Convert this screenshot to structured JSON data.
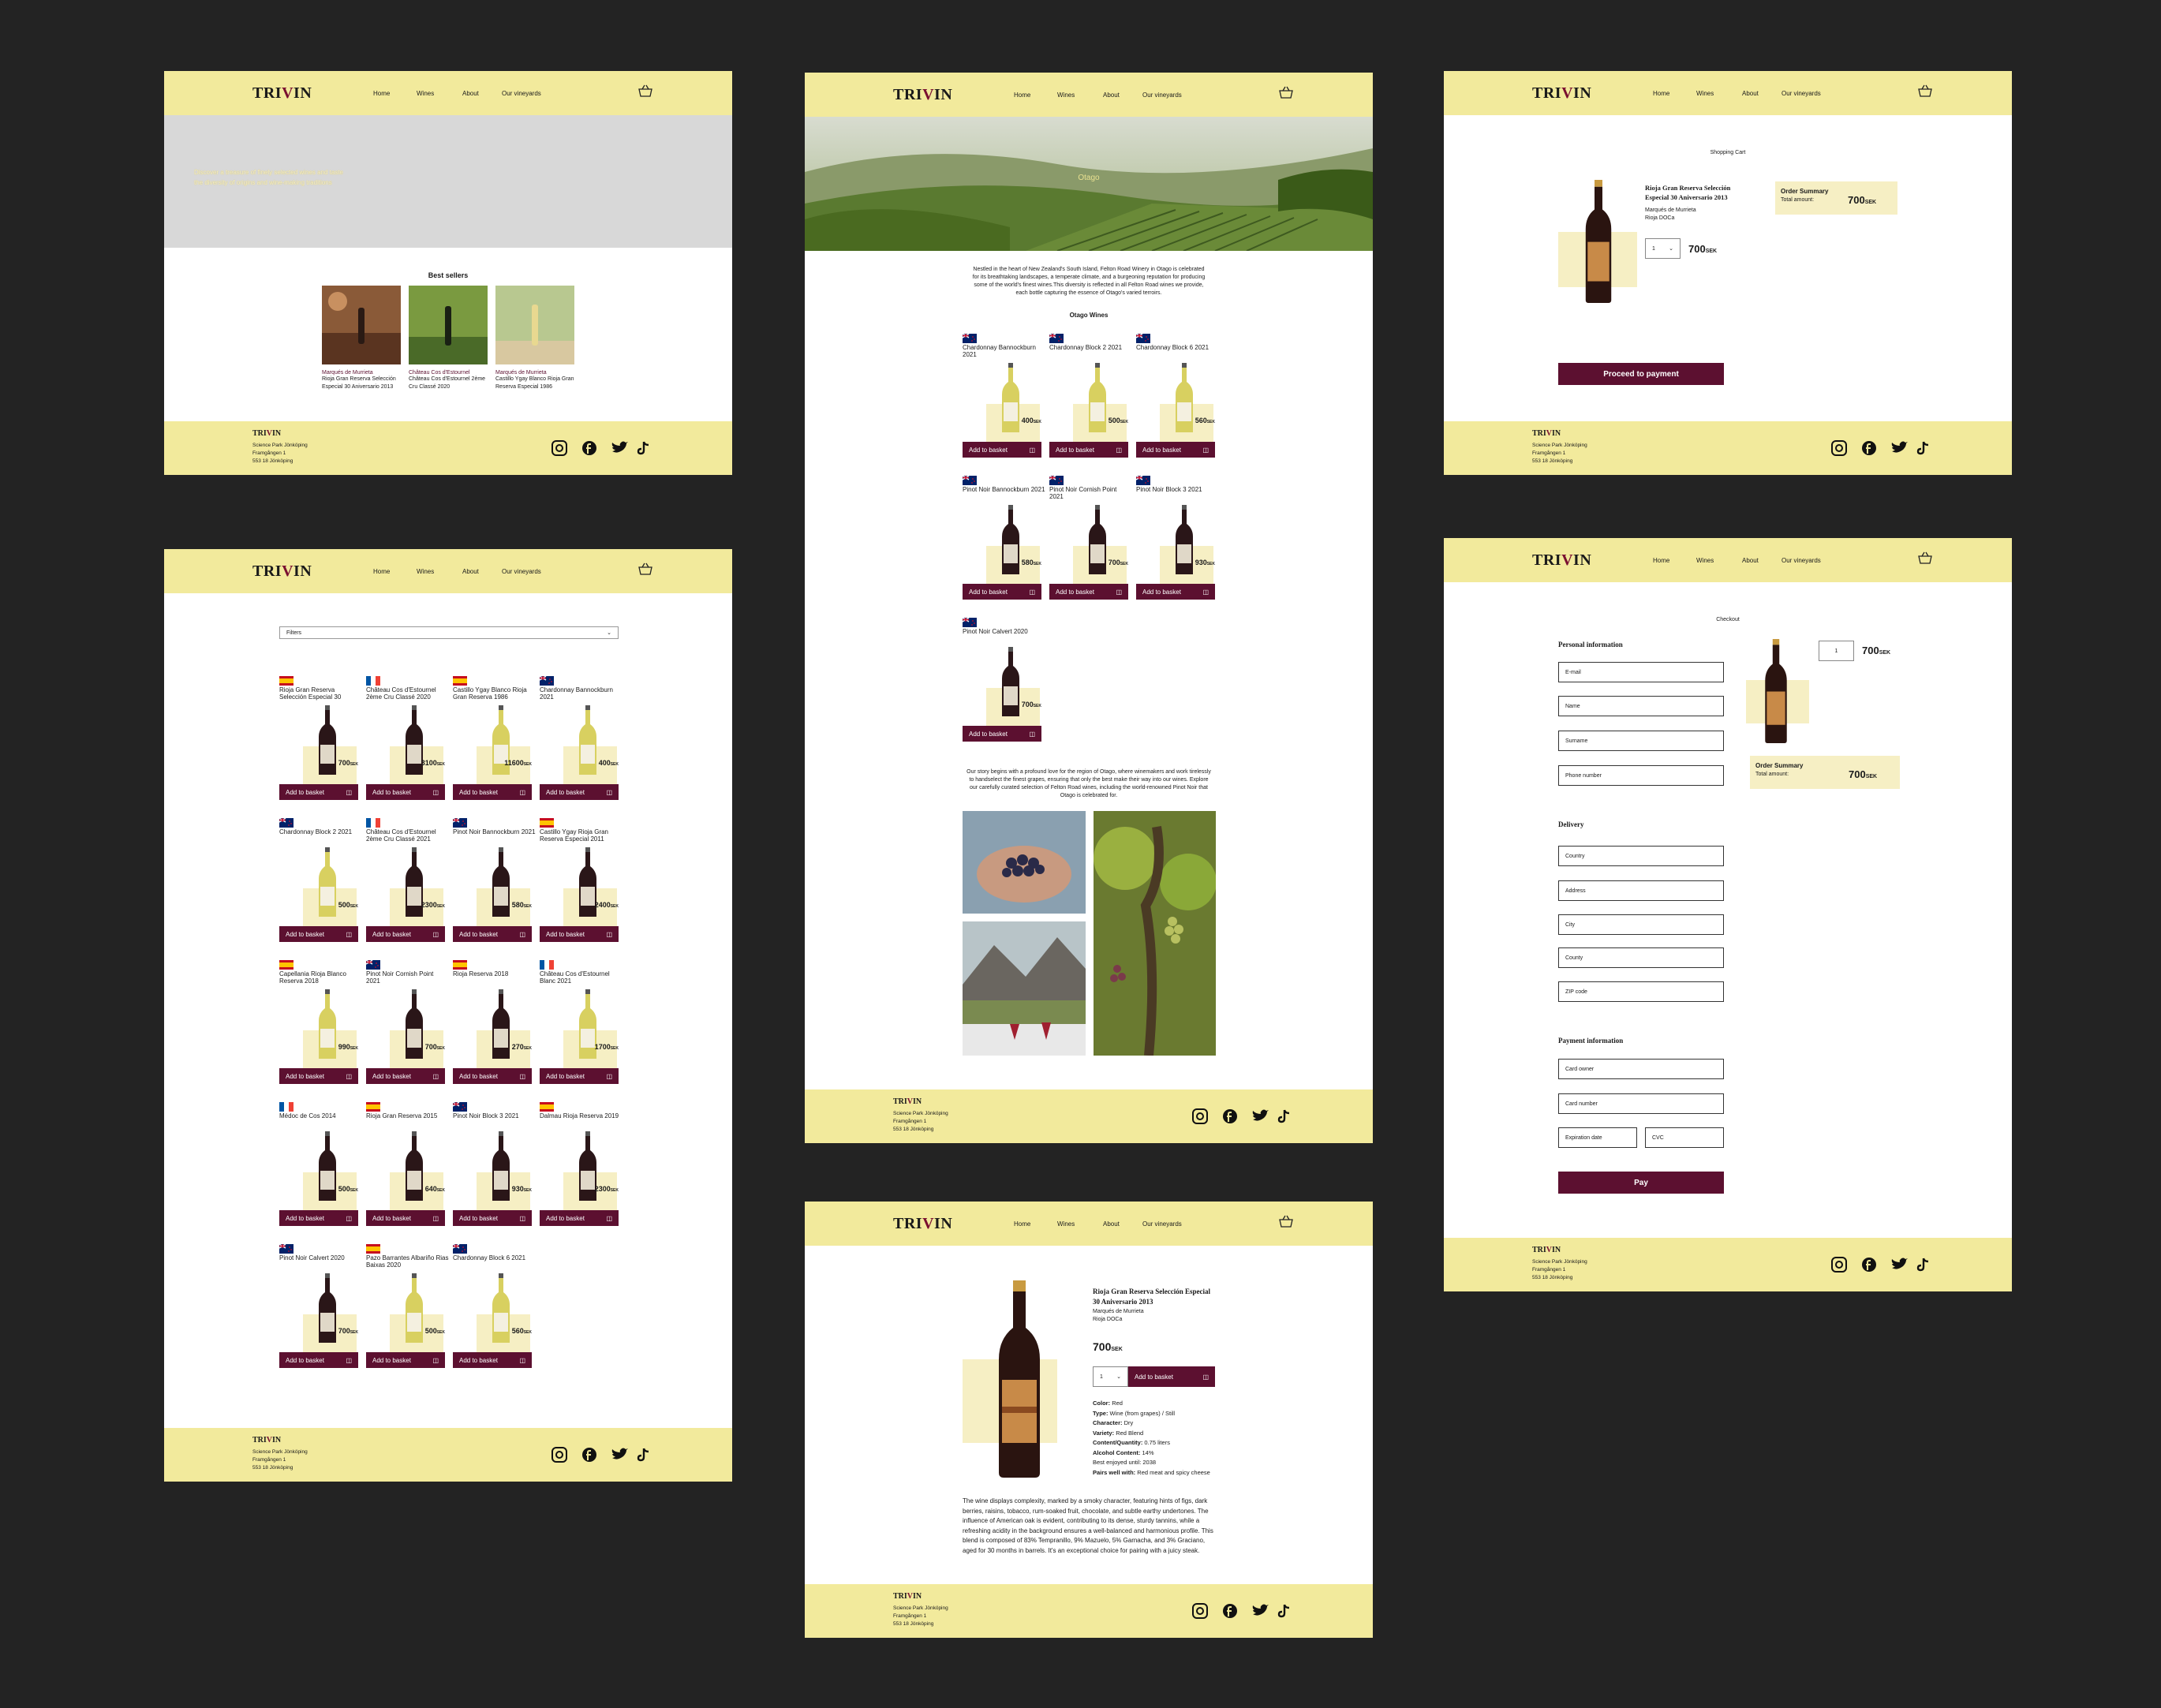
{
  "brand": {
    "logo_pre": "TRI",
    "logo_v": "V",
    "logo_post": "IN"
  },
  "nav": {
    "home": "Home",
    "wines": "Wines",
    "about": "About",
    "vineyards": "Our vineyards"
  },
  "footer": {
    "address1": "Science Park Jönköping",
    "address2": "Framgången 1",
    "address3": "553 18 Jönköping"
  },
  "home": {
    "hero_text": "Discover a treasure of finely selected wines and taste the diversity of origins and wine-making traditions",
    "best_sellers_title": "Best sellers",
    "best_sellers": [
      {
        "producer": "Marqués de Murrieta",
        "name": "Rioja Gran Reserva Selección Especial 30 Aniversario 2013"
      },
      {
        "producer": "Château Cos d'Estournel",
        "name": "Château Cos d'Estournel 2ème Cru Classé 2020"
      },
      {
        "producer": "Marqués de Murrieta",
        "name": "Castillo Ygay Blanco Rioja Gran Reserva Especial 1986"
      }
    ]
  },
  "wines": {
    "filter_label": "Filters",
    "add_label": "Add to basket",
    "products": [
      {
        "name": "Rioja Gran Reserva Selección Especial 30",
        "price": "700",
        "flag": "es",
        "color": "red"
      },
      {
        "name": "Château Cos d'Estournel 2ème Cru Classé 2020",
        "price": "3100",
        "flag": "fr",
        "color": "red"
      },
      {
        "name": "Castillo Ygay Blanco Rioja Gran Reserva 1986",
        "price": "11600",
        "flag": "es",
        "color": "white"
      },
      {
        "name": "Chardonnay Bannockburn 2021",
        "price": "400",
        "flag": "nz",
        "color": "white"
      },
      {
        "name": "Chardonnay Block 2 2021",
        "price": "500",
        "flag": "nz",
        "color": "white"
      },
      {
        "name": "Château Cos d'Estournel 2ème Cru Classé 2021",
        "price": "2300",
        "flag": "fr",
        "color": "red"
      },
      {
        "name": "Pinot Noir Bannockburn 2021",
        "price": "580",
        "flag": "nz",
        "color": "red"
      },
      {
        "name": "Castillo Ygay Rioja Gran Reserva Especial 2011",
        "price": "2400",
        "flag": "es",
        "color": "red"
      },
      {
        "name": "Capellania Rioja Blanco Reserva 2018",
        "price": "990",
        "flag": "es",
        "color": "white"
      },
      {
        "name": "Pinot Noir Cornish Point 2021",
        "price": "700",
        "flag": "nz",
        "color": "red"
      },
      {
        "name": "Rioja Reserva 2018",
        "price": "270",
        "flag": "es",
        "color": "red"
      },
      {
        "name": "Château Cos d'Estournel Blanc 2021",
        "price": "1700",
        "flag": "fr",
        "color": "white"
      },
      {
        "name": "Médoc de Cos 2014",
        "price": "500",
        "flag": "fr",
        "color": "red"
      },
      {
        "name": "Rioja Gran Reserva 2015",
        "price": "640",
        "flag": "es",
        "color": "red"
      },
      {
        "name": "Pinot Noir Block 3 2021",
        "price": "930",
        "flag": "nz",
        "color": "red"
      },
      {
        "name": "Dalmau Rioja Reserva 2019",
        "price": "2300",
        "flag": "es",
        "color": "red"
      },
      {
        "name": "Pinot Noir Calvert 2020",
        "price": "700",
        "flag": "nz",
        "color": "red"
      },
      {
        "name": "Pazo Barrantes Albariño Rias Baixas 2020",
        "price": "500",
        "flag": "es",
        "color": "white"
      },
      {
        "name": "Chardonnay Block 6 2021",
        "price": "560",
        "flag": "nz",
        "color": "white"
      }
    ]
  },
  "otago": {
    "hero_title": "Otago",
    "intro": "Nestled in the heart of New Zealand's South Island, Felton Road Winery in Otago is celebrated for its breathtaking landscapes, a temperate climate, and a burgeoning reputation for producing some of the world's finest wines.This diversity is reflected in all Felton Road wines we provide, each bottle capturing the essence of Otago's varied terroirs.",
    "wines_title": "Otago Wines",
    "products": [
      {
        "name": "Chardonnay Bannockburn 2021",
        "price": "400",
        "color": "white"
      },
      {
        "name": "Chardonnay Block 2 2021",
        "price": "500",
        "color": "white"
      },
      {
        "name": "Chardonnay Block 6 2021",
        "price": "560",
        "color": "white"
      },
      {
        "name": "Pinot Noir Bannockburn 2021",
        "price": "580",
        "color": "red"
      },
      {
        "name": "Pinot Noir Cornish Point 2021",
        "price": "700",
        "color": "red"
      },
      {
        "name": "Pinot Noir Block 3 2021",
        "price": "930",
        "color": "red"
      },
      {
        "name": "Pinot Noir Calvert 2020",
        "price": "700",
        "color": "red"
      }
    ],
    "story": "Our story begins with a profound love for the region of Otago, where winemakers and work tirelessly to handselect the finest grapes, ensuring that only the best make their way into our wines. Explore our carefully curated selection of Felton Road wines, including the world-renowned Pinot Noir that Otago is celebrated for."
  },
  "product": {
    "name": "Rioja Gran Reserva Selección Especial 30 Aniversario 2013",
    "producer": "Marqués de Murrieta",
    "region": "Rioja DOCa",
    "price": "700",
    "currency": "SEK",
    "qty": "1",
    "add_label": "Add to basket",
    "specs": [
      {
        "k": "Color:",
        "v": "Red"
      },
      {
        "k": "Type:",
        "v": "Wine (from grapes) / Still"
      },
      {
        "k": "Character:",
        "v": "Dry"
      },
      {
        "k": "Variety:",
        "v": "Red Blend"
      },
      {
        "k": "Content/Quantity:",
        "v": "0.75 liters"
      },
      {
        "k": "Alcohol Content:",
        "v": "14%"
      },
      {
        "k": "",
        "v": "Best enjoyed until: 2038"
      },
      {
        "k": "Pairs well with:",
        "v": "Red meat and spicy cheese"
      }
    ],
    "description": "The wine displays complexity, marked by a smoky character, featuring hints of figs, dark berries, raisins, tobacco, rum-soaked fruit, chocolate, and subtle earthy undertones. The influence of American oak is evident, contributing to its dense, sturdy tannins, while a refreshing acidity in the background ensures a well-balanced and harmonious profile. This blend is composed of 83% Tempranillo, 9% Mazuelo, 5% Garnacha, and 3% Graciano, aged for 30 months in barrels. It's an exceptional choice for pairing with a juicy steak."
  },
  "cart": {
    "title": "Shopping Cart",
    "item_name": "Rioja Gran Reserva Selección Especial 30 Aniversario 2013",
    "producer": "Marqués de Murrieta",
    "region": "Rioja DOCa",
    "qty": "1",
    "price": "700",
    "currency": "SEK",
    "summary_title": "Order Summary",
    "total_label": "Total amount:",
    "total": "700",
    "proceed": "Proceed to payment"
  },
  "checkout": {
    "title": "Checkout",
    "personal_title": "Personal information",
    "personal_fields": [
      "E-mail",
      "Name",
      "Surname",
      "Phone number"
    ],
    "delivery_title": "Delivery",
    "delivery_fields": [
      "Country",
      "Address",
      "City",
      "County",
      "ZIP code"
    ],
    "payment_title": "Payment information",
    "payment_fields": [
      "Card owner",
      "Card number"
    ],
    "expiration": "Expiration date",
    "cvc": "CVC",
    "pay": "Pay",
    "qty": "1",
    "price": "700",
    "currency": "SEK",
    "summary_title": "Order Summary",
    "total_label": "Total amount:",
    "total": "700"
  },
  "colors": {
    "accent": "#5c1030",
    "header": "#f2ea9c",
    "label_bg": "#f6efc4",
    "canvas": "#232323"
  }
}
